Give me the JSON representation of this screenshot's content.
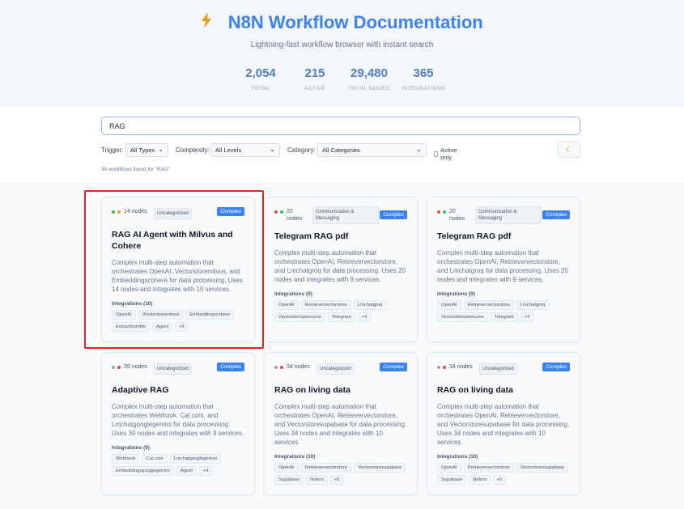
{
  "header": {
    "title": "N8N Workflow Documentation",
    "subtitle": "Lightning-fast workflow browser with instant search",
    "icon": "lightning-bolt-icon",
    "stats": [
      {
        "value": "2,054",
        "label": "TOTAL"
      },
      {
        "value": "215",
        "label": "ACTIVE"
      },
      {
        "value": "29,480",
        "label": "TOTAL NODES"
      },
      {
        "value": "365",
        "label": "INTEGRATIONS"
      }
    ]
  },
  "search": {
    "value": "RAG"
  },
  "filters": {
    "trigger_label": "Trigger:",
    "trigger_value": "All Types",
    "complexity_label": "Complexity:",
    "complexity_value": "All Levels",
    "category_label": "Category:",
    "category_value": "All Categories",
    "active_only_label": "Active only",
    "theme_icon": "moon-icon"
  },
  "results_text": "30 workflows found for \"RAG\"",
  "colors": {
    "accent": "#3b82f6",
    "bolt": "#f59e0b",
    "highlight": "#dc2626"
  },
  "cards": [
    {
      "nodes": "14 nodes",
      "category": "Uncategorized",
      "complexity": "Complex",
      "dots": [
        "#22c55e",
        "#f59e0b"
      ],
      "title": "RAG AI Agent with Milvus and Cohere",
      "description": "Complex multi-step automation that orchestrates OpenAI, Vectorstoremilvus, and Embeddingscohere for data processing. Uses 14 nodes and integrates with 10 services.",
      "integrations_label": "Integrations (10)",
      "tags": [
        "OpenAI",
        "Vectorstoremilvus",
        "Embeddingscohere",
        "Extractfromfile",
        "Agent",
        "+5"
      ]
    },
    {
      "nodes": "20 nodes",
      "category": "Communication & Messaging",
      "complexity": "Complex",
      "dots": [
        "#ef4444",
        "#22c55e"
      ],
      "title": "Telegram RAG pdf",
      "description": "Complex multi-step automation that orchestrates OpenAI, Retrievervectorstore, and Lmchatgroq for data processing. Uses 20 nodes and integrates with 9 services.",
      "integrations_label": "Integrations (9)",
      "tags": [
        "OpenAI",
        "Retrievervectorstore",
        "Lmchatgroq",
        "Vectorstorepinecone",
        "Telegram",
        "+4"
      ]
    },
    {
      "nodes": "20 nodes",
      "category": "Communication & Messaging",
      "complexity": "Complex",
      "dots": [
        "#ef4444",
        "#22c55e"
      ],
      "title": "Telegram RAG pdf",
      "description": "Complex multi-step automation that orchestrates OpenAI, Retrievervectorstore, and Lmchatgroq for data processing. Uses 20 nodes and integrates with 9 services.",
      "integrations_label": "Integrations (9)",
      "tags": [
        "OpenAI",
        "Retrievervectorstore",
        "Lmchatgroq",
        "Vectorstorepinecone",
        "Telegram",
        "+4"
      ]
    },
    {
      "nodes": "39 nodes",
      "category": "Uncategorized",
      "complexity": "Complex",
      "dots": [
        "#94a3b8",
        "#ef4444"
      ],
      "title": "Adaptive RAG",
      "description": "Complex multi-step automation that orchestrates Webhook, Cal.com, and Lmchatgooglegemini for data processing. Uses 39 nodes and integrates with 9 services.",
      "integrations_label": "Integrations (9)",
      "tags": [
        "Webhook",
        "Cal.com",
        "Lmchatgooglegemini",
        "Embeddingsgooglegemini",
        "Agent",
        "+4"
      ]
    },
    {
      "nodes": "34 nodes",
      "category": "Uncategorized",
      "complexity": "Complex",
      "dots": [
        "#94a3b8",
        "#ef4444"
      ],
      "title": "RAG on living data",
      "description": "Complex multi-step automation that orchestrates OpenAI, Retrievervectorstore, and Vectorstoresupabase for data processing. Uses 34 nodes and integrates with 10 services.",
      "integrations_label": "Integrations (10)",
      "tags": [
        "OpenAI",
        "Retrievervectorstore",
        "Vectorstoresupabase",
        "Supabase",
        "Notion",
        "+5"
      ]
    },
    {
      "nodes": "34 nodes",
      "category": "Uncategorized",
      "complexity": "Complex",
      "dots": [
        "#94a3b8",
        "#ef4444"
      ],
      "title": "RAG on living data",
      "description": "Complex multi-step automation that orchestrates OpenAI, Retrievervectorstore, and Vectorstoresupabase for data processing. Uses 34 nodes and integrates with 10 services.",
      "integrations_label": "Integrations (10)",
      "tags": [
        "OpenAI",
        "Retrievervectorstore",
        "Vectorstoresupabase",
        "Supabase",
        "Notion",
        "+5"
      ]
    }
  ]
}
